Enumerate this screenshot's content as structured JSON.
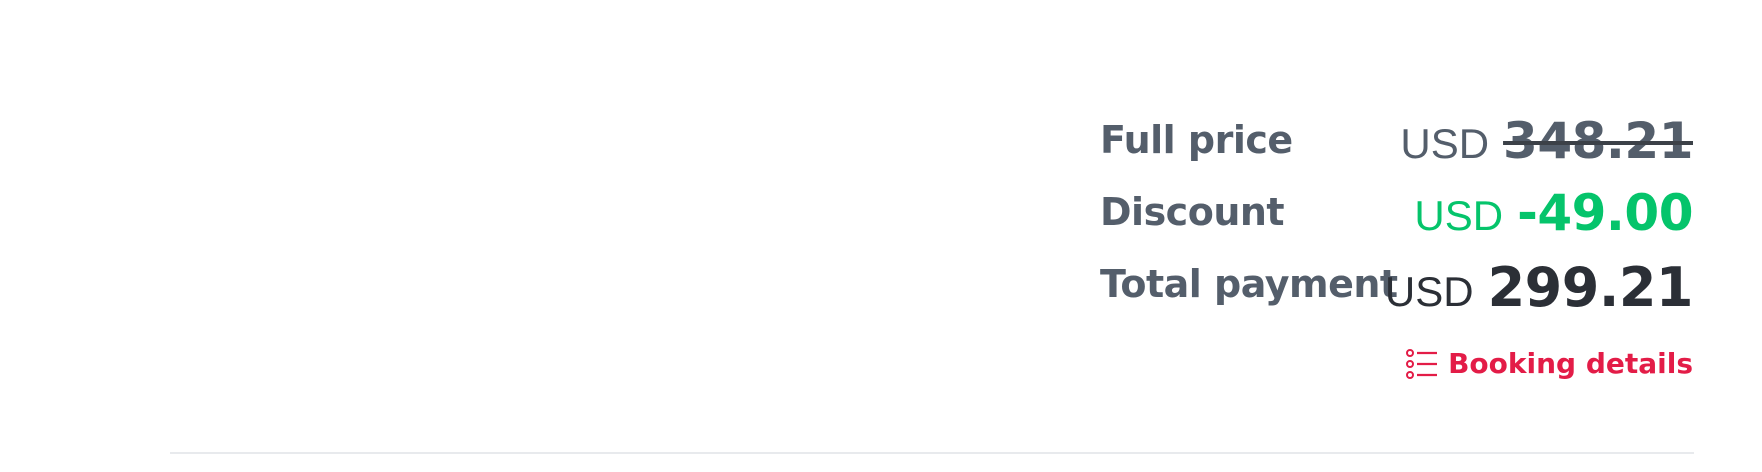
{
  "price_summary": {
    "full_price": {
      "label": "Full price",
      "currency": "USD",
      "amount": "348.21",
      "struck_through": true
    },
    "discount": {
      "label": "Discount",
      "currency": "USD",
      "amount": "-49.00"
    },
    "total_payment": {
      "label": "Total payment",
      "currency": "USD",
      "amount": "299.21"
    },
    "booking_details_link": {
      "label": "Booking details",
      "icon": "list-icon"
    }
  },
  "colors": {
    "label": "#545e6b",
    "discount_green": "#05c46b",
    "total_dark": "#2b2f36",
    "link_red": "#e31c47",
    "divider": "#e8eaed"
  }
}
